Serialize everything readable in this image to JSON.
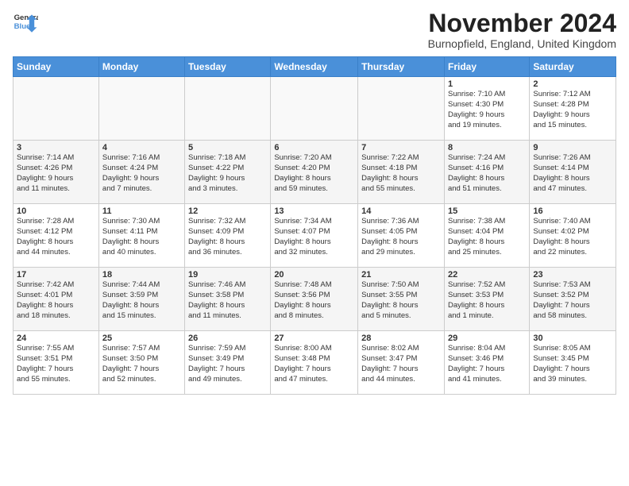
{
  "logo": {
    "line1": "General",
    "line2": "Blue"
  },
  "title": "November 2024",
  "subtitle": "Burnopfield, England, United Kingdom",
  "days_header": [
    "Sunday",
    "Monday",
    "Tuesday",
    "Wednesday",
    "Thursday",
    "Friday",
    "Saturday"
  ],
  "weeks": [
    [
      {
        "day": "",
        "info": ""
      },
      {
        "day": "",
        "info": ""
      },
      {
        "day": "",
        "info": ""
      },
      {
        "day": "",
        "info": ""
      },
      {
        "day": "",
        "info": ""
      },
      {
        "day": "1",
        "info": "Sunrise: 7:10 AM\nSunset: 4:30 PM\nDaylight: 9 hours\nand 19 minutes."
      },
      {
        "day": "2",
        "info": "Sunrise: 7:12 AM\nSunset: 4:28 PM\nDaylight: 9 hours\nand 15 minutes."
      }
    ],
    [
      {
        "day": "3",
        "info": "Sunrise: 7:14 AM\nSunset: 4:26 PM\nDaylight: 9 hours\nand 11 minutes."
      },
      {
        "day": "4",
        "info": "Sunrise: 7:16 AM\nSunset: 4:24 PM\nDaylight: 9 hours\nand 7 minutes."
      },
      {
        "day": "5",
        "info": "Sunrise: 7:18 AM\nSunset: 4:22 PM\nDaylight: 9 hours\nand 3 minutes."
      },
      {
        "day": "6",
        "info": "Sunrise: 7:20 AM\nSunset: 4:20 PM\nDaylight: 8 hours\nand 59 minutes."
      },
      {
        "day": "7",
        "info": "Sunrise: 7:22 AM\nSunset: 4:18 PM\nDaylight: 8 hours\nand 55 minutes."
      },
      {
        "day": "8",
        "info": "Sunrise: 7:24 AM\nSunset: 4:16 PM\nDaylight: 8 hours\nand 51 minutes."
      },
      {
        "day": "9",
        "info": "Sunrise: 7:26 AM\nSunset: 4:14 PM\nDaylight: 8 hours\nand 47 minutes."
      }
    ],
    [
      {
        "day": "10",
        "info": "Sunrise: 7:28 AM\nSunset: 4:12 PM\nDaylight: 8 hours\nand 44 minutes."
      },
      {
        "day": "11",
        "info": "Sunrise: 7:30 AM\nSunset: 4:11 PM\nDaylight: 8 hours\nand 40 minutes."
      },
      {
        "day": "12",
        "info": "Sunrise: 7:32 AM\nSunset: 4:09 PM\nDaylight: 8 hours\nand 36 minutes."
      },
      {
        "day": "13",
        "info": "Sunrise: 7:34 AM\nSunset: 4:07 PM\nDaylight: 8 hours\nand 32 minutes."
      },
      {
        "day": "14",
        "info": "Sunrise: 7:36 AM\nSunset: 4:05 PM\nDaylight: 8 hours\nand 29 minutes."
      },
      {
        "day": "15",
        "info": "Sunrise: 7:38 AM\nSunset: 4:04 PM\nDaylight: 8 hours\nand 25 minutes."
      },
      {
        "day": "16",
        "info": "Sunrise: 7:40 AM\nSunset: 4:02 PM\nDaylight: 8 hours\nand 22 minutes."
      }
    ],
    [
      {
        "day": "17",
        "info": "Sunrise: 7:42 AM\nSunset: 4:01 PM\nDaylight: 8 hours\nand 18 minutes."
      },
      {
        "day": "18",
        "info": "Sunrise: 7:44 AM\nSunset: 3:59 PM\nDaylight: 8 hours\nand 15 minutes."
      },
      {
        "day": "19",
        "info": "Sunrise: 7:46 AM\nSunset: 3:58 PM\nDaylight: 8 hours\nand 11 minutes."
      },
      {
        "day": "20",
        "info": "Sunrise: 7:48 AM\nSunset: 3:56 PM\nDaylight: 8 hours\nand 8 minutes."
      },
      {
        "day": "21",
        "info": "Sunrise: 7:50 AM\nSunset: 3:55 PM\nDaylight: 8 hours\nand 5 minutes."
      },
      {
        "day": "22",
        "info": "Sunrise: 7:52 AM\nSunset: 3:53 PM\nDaylight: 8 hours\nand 1 minute."
      },
      {
        "day": "23",
        "info": "Sunrise: 7:53 AM\nSunset: 3:52 PM\nDaylight: 7 hours\nand 58 minutes."
      }
    ],
    [
      {
        "day": "24",
        "info": "Sunrise: 7:55 AM\nSunset: 3:51 PM\nDaylight: 7 hours\nand 55 minutes."
      },
      {
        "day": "25",
        "info": "Sunrise: 7:57 AM\nSunset: 3:50 PM\nDaylight: 7 hours\nand 52 minutes."
      },
      {
        "day": "26",
        "info": "Sunrise: 7:59 AM\nSunset: 3:49 PM\nDaylight: 7 hours\nand 49 minutes."
      },
      {
        "day": "27",
        "info": "Sunrise: 8:00 AM\nSunset: 3:48 PM\nDaylight: 7 hours\nand 47 minutes."
      },
      {
        "day": "28",
        "info": "Sunrise: 8:02 AM\nSunset: 3:47 PM\nDaylight: 7 hours\nand 44 minutes."
      },
      {
        "day": "29",
        "info": "Sunrise: 8:04 AM\nSunset: 3:46 PM\nDaylight: 7 hours\nand 41 minutes."
      },
      {
        "day": "30",
        "info": "Sunrise: 8:05 AM\nSunset: 3:45 PM\nDaylight: 7 hours\nand 39 minutes."
      }
    ]
  ]
}
